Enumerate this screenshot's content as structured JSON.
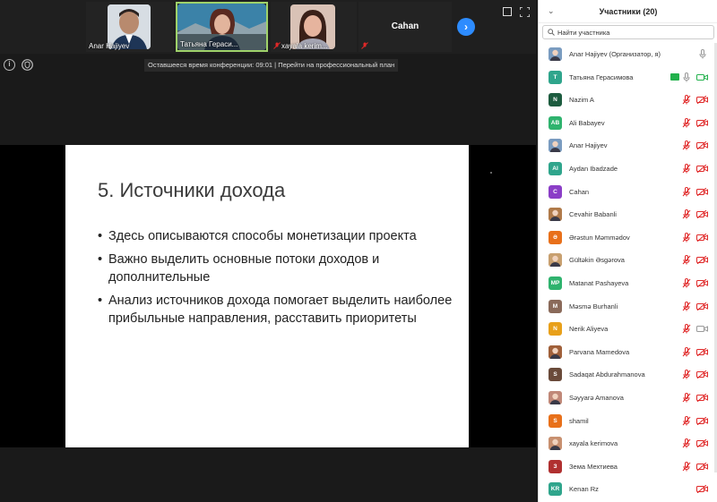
{
  "gallery": {
    "tiles": [
      {
        "name": "Anar Hajiyev"
      },
      {
        "name": "Татьяна Гераси..."
      },
      {
        "name": "xayala kerim..."
      },
      {
        "name": "Cahan"
      }
    ],
    "next_arrow": "›"
  },
  "info_icon_text": "i",
  "timer": "Оставшееся время конференции: 09:01 | Перейти на профессиональный план",
  "slide": {
    "title": "5. Источники дохода",
    "bullets": [
      "Здесь описываются способы монетизации проекта",
      "Важно выделить основные потоки доходов и дополнительные",
      "Анализ источников дохода помогает выделить наиболее прибыльные направления, расставить приоритеты"
    ]
  },
  "panel": {
    "title": "Участники (20)",
    "collapse_icon": "⌄",
    "search_placeholder": "Найти участника",
    "participants": [
      {
        "name": "Anar Hajiyev (Организатор, я)",
        "avatar": "",
        "color": "#7a9cc0",
        "photo": true,
        "mic": "on",
        "cam": "none"
      },
      {
        "name": "Татьяна Герасимова",
        "avatar": "T",
        "color": "#2fa58c",
        "photo": false,
        "mic": "on-green",
        "cam": "on-green",
        "sharing": true
      },
      {
        "name": "Nazim A",
        "avatar": "N",
        "color": "#1d5c3f",
        "photo": false,
        "mic": "off",
        "cam": "off"
      },
      {
        "name": "Ali Babayev",
        "avatar": "AB",
        "color": "#2fb36e",
        "photo": false,
        "mic": "off",
        "cam": "off"
      },
      {
        "name": "Anar Hajiyev",
        "avatar": "",
        "color": "#7a9cc0",
        "photo": true,
        "mic": "off",
        "cam": "off"
      },
      {
        "name": "Aydan Ibadzade",
        "avatar": "AI",
        "color": "#2fa58c",
        "photo": false,
        "mic": "off",
        "cam": "off"
      },
      {
        "name": "Cahan",
        "avatar": "C",
        "color": "#8b3ec7",
        "photo": false,
        "mic": "off",
        "cam": "off"
      },
      {
        "name": "Cevahir Babanli",
        "avatar": "",
        "color": "#b07a4a",
        "photo": true,
        "mic": "off",
        "cam": "off"
      },
      {
        "name": "Ərəstun Məmmədov",
        "avatar": "Ə",
        "color": "#e8701a",
        "photo": false,
        "mic": "off",
        "cam": "off"
      },
      {
        "name": "Gültəkin Əsgərova",
        "avatar": "",
        "color": "#c8a070",
        "photo": true,
        "mic": "off",
        "cam": "off"
      },
      {
        "name": "Matanat Pashayeva",
        "avatar": "MP",
        "color": "#2fb36e",
        "photo": false,
        "mic": "off",
        "cam": "off"
      },
      {
        "name": "Məsmə Burhanli",
        "avatar": "M",
        "color": "#8a6a5a",
        "photo": false,
        "mic": "off",
        "cam": "off"
      },
      {
        "name": "Nerik Aliyeva",
        "avatar": "N",
        "color": "#e8a01a",
        "photo": false,
        "mic": "off",
        "cam": "none-outline"
      },
      {
        "name": "Parvana Mamedova",
        "avatar": "",
        "color": "#a0603a",
        "photo": true,
        "mic": "off",
        "cam": "off"
      },
      {
        "name": "Sadaqat Abdurahmanova",
        "avatar": "S",
        "color": "#6a4a3a",
        "photo": false,
        "mic": "off",
        "cam": "off"
      },
      {
        "name": "Səyyarə Amanova",
        "avatar": "",
        "color": "#c08878",
        "photo": true,
        "mic": "off",
        "cam": "off"
      },
      {
        "name": "shamil",
        "avatar": "S",
        "color": "#e8701a",
        "photo": false,
        "mic": "off",
        "cam": "off"
      },
      {
        "name": "xayala kerimova",
        "avatar": "",
        "color": "#c89070",
        "photo": true,
        "mic": "off",
        "cam": "off"
      },
      {
        "name": "Зема Мехтиева",
        "avatar": "З",
        "color": "#b03030",
        "photo": false,
        "mic": "off",
        "cam": "off"
      },
      {
        "name": "Kenan Rz",
        "avatar": "KR",
        "color": "#2fa58c",
        "photo": false,
        "mic": "none",
        "cam": "off"
      }
    ]
  }
}
